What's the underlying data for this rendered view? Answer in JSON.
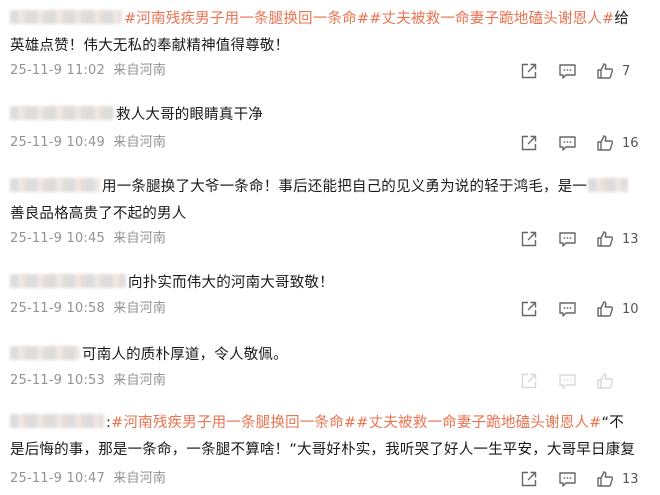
{
  "comments": [
    {
      "topic1": "#河南残疾男子用一条腿换回一条命#",
      "topic2": "#丈夫被救一命妻子跪地磕头谢恩人#",
      "text_a": "给",
      "text_b": "英雄点赞！伟大无私的奉献精神值得尊敬！",
      "time": "25-11-9 11:02",
      "location": "来自河南",
      "likes": "7"
    },
    {
      "text": "救人大哥的眼睛真干净",
      "time": "25-11-9 10:49",
      "location": "来自河南",
      "likes": "16"
    },
    {
      "text_a": "用一条腿换了大爷一条命！事后还能把自己的见义勇为说的轻于鸿毛，是一",
      "text_b": "善良品格高贵了不起的男人",
      "time": "25-11-9 10:45",
      "location": "来自河南",
      "likes": "13"
    },
    {
      "text": "向扑实而伟大的河南大哥致敬！",
      "time": "25-11-9 10:58",
      "location": "来自河南",
      "likes": "10"
    },
    {
      "text": "可南人的质朴厚道，令人敬佩。",
      "time": "25-11-9 10:53",
      "location": "来自河南",
      "likes": ""
    },
    {
      "prefix": ":",
      "topic1": "#河南残疾男子用一条腿换回一条命#",
      "topic2": "#丈夫被救一命妻子跪地磕头谢恩人#",
      "text_a": "“不",
      "text_b": "是后悔的事，那是一条命，一条腿不算啥！”大哥好朴实，我听哭了好人一生平安，大哥早日康复",
      "time": "25-11-9 10:47",
      "location": "来自河南",
      "likes": "13"
    }
  ],
  "icons": {
    "share": "share-icon",
    "comment": "comment-icon",
    "like": "thumbs-up-icon"
  },
  "colors": {
    "topic": "#eb7350",
    "meta": "#939393",
    "text": "#1a1a1a"
  }
}
